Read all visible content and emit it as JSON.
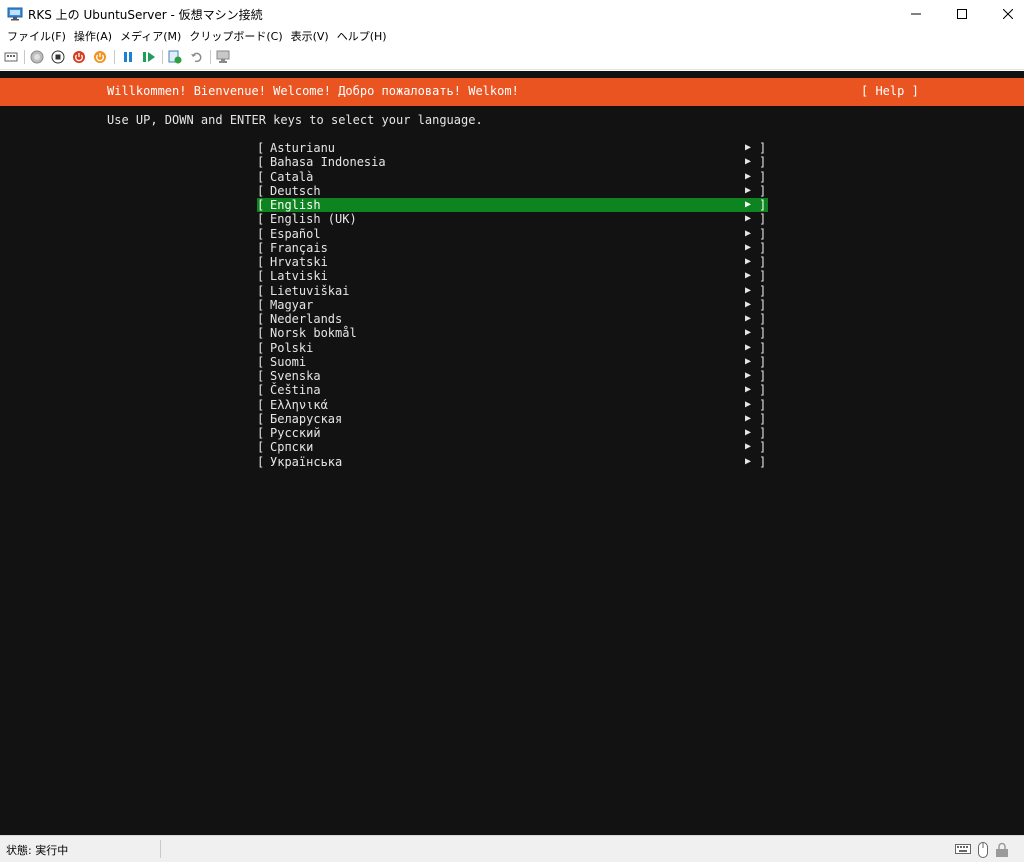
{
  "window": {
    "title": "RKS 上の UbuntuServer - 仮想マシン接続"
  },
  "menu": [
    "ファイル(F)",
    "操作(A)",
    "メディア(M)",
    "クリップボード(C)",
    "表示(V)",
    "ヘルプ(H)"
  ],
  "toolbar": {
    "icons": [
      "ctrl-alt-del-icon",
      "start-icon",
      "turn-off-icon",
      "shutdown-icon",
      "save-icon",
      "pause-icon",
      "reset-icon",
      "checkpoint-icon",
      "revert-icon",
      "enhanced-session-icon"
    ]
  },
  "console": {
    "welcome": "Willkommen! Bienvenue! Welcome! Добро пожаловать! Welkom!",
    "help": "[ Help ]",
    "instruction": "Use UP, DOWN and ENTER keys to select your language.",
    "bracket_left": "[",
    "bracket_right": "]",
    "arrow": "▶",
    "selected_index": 4,
    "languages": [
      "Asturianu",
      "Bahasa Indonesia",
      "Català",
      "Deutsch",
      "English",
      "English (UK)",
      "Español",
      "Français",
      "Hrvatski",
      "Latviski",
      "Lietuviškai",
      "Magyar",
      "Nederlands",
      "Norsk bokmål",
      "Polski",
      "Suomi",
      "Svenska",
      "Čeština",
      "Ελληνικά",
      "Беларуская",
      "Русский",
      "Српски",
      "Українська"
    ]
  },
  "status": {
    "text": "状態: 実行中"
  },
  "colors": {
    "ubuntu_orange": "#e95420",
    "selection_green": "#0e8420",
    "console_bg": "#121212"
  }
}
